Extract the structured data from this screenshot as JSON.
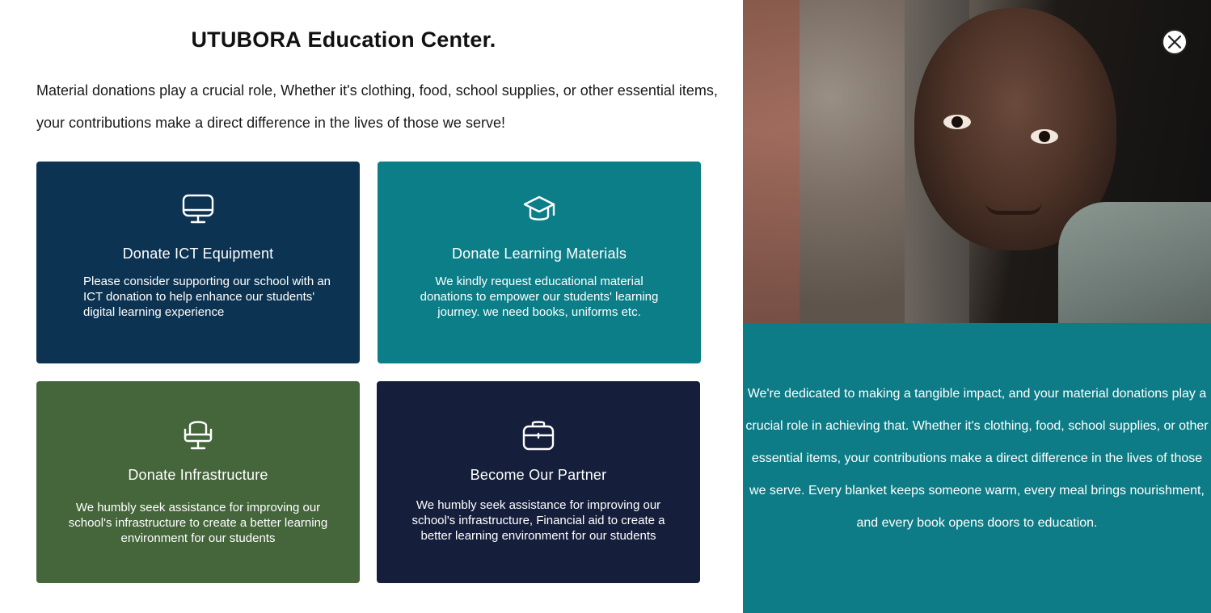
{
  "header": {
    "title_bold": "UTUBORA",
    "title_rest": " Education Center."
  },
  "intro_text": "Material donations play a crucial role, Whether it's clothing, food, school supplies, or other essential items, your contributions make a direct difference in the lives of those we serve!",
  "cards": [
    {
      "title": "Donate ICT Equipment",
      "description": "Please consider supporting our school with an ICT donation to help enhance our students' digital learning experience",
      "icon": "monitor-icon",
      "color": "#0c3352"
    },
    {
      "title": "Donate Learning Materials",
      "description": "We kindly request educational material donations to empower our students' learning journey. we need books, uniforms etc.",
      "icon": "graduation-cap-icon",
      "color": "#0b7e88"
    },
    {
      "title": "Donate Infrastructure",
      "description": "We humbly seek assistance for improving our school's infrastructure to create a better learning environment for our students",
      "icon": "chair-icon",
      "color": "#44663a"
    },
    {
      "title": "Become Our Partner",
      "description": "We humbly seek assistance for improving our school's infrastructure, Financial aid to create a better learning environment for our students",
      "icon": "briefcase-icon",
      "color": "#151f3b"
    }
  ],
  "side_panel": {
    "close_icon": "close-icon",
    "text": "We're dedicated to making a tangible impact, and your material donations play a crucial role in achieving that. Whether it's clothing, food, school supplies, or other essential items, your contributions make a direct difference in the lives of those we serve. Every blanket keeps someone warm, every meal brings nourishment, and every book opens doors to education.",
    "background": "#0d7c86"
  }
}
